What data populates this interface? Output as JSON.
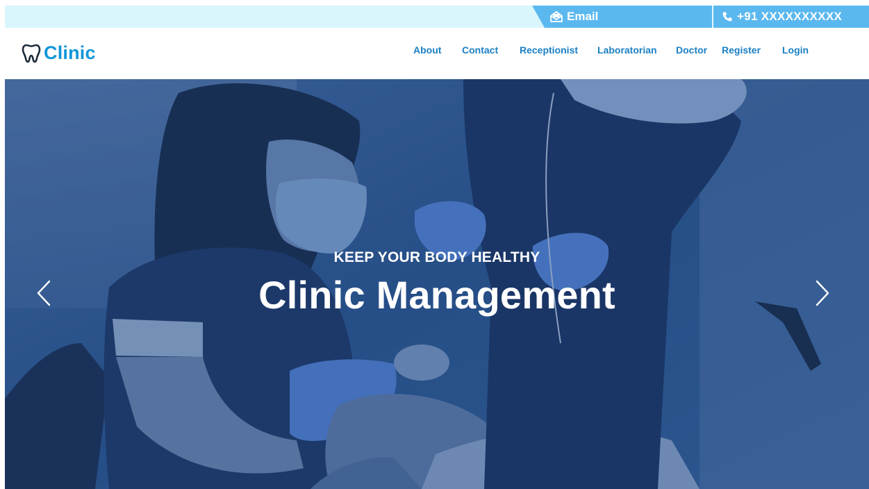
{
  "topbar": {
    "email_icon": "envelope-open-icon",
    "email_label": "Email",
    "phone_icon": "phone-icon",
    "phone_label": "+91 XXXXXXXXXX"
  },
  "brand": {
    "icon": "tooth-icon",
    "name": "Clinic"
  },
  "nav": {
    "items": [
      {
        "label": "About"
      },
      {
        "label": "Contact"
      },
      {
        "label": "Receptionist"
      },
      {
        "label": "Laboratorian"
      },
      {
        "label": "Doctor"
      },
      {
        "label": "Register"
      },
      {
        "label": "Login"
      }
    ]
  },
  "hero": {
    "eyebrow": "KEEP YOUR BODY HEALTHY",
    "title": "Clinic Management",
    "prev_icon": "chevron-left-icon",
    "next_icon": "chevron-right-icon"
  },
  "colors": {
    "brand": "#1296d8",
    "nav_link": "#1a7fc3",
    "topbar_bg": "#d9f6fd",
    "topbar_accent": "#5bb8ef",
    "hero_overlay": "#163a73"
  }
}
